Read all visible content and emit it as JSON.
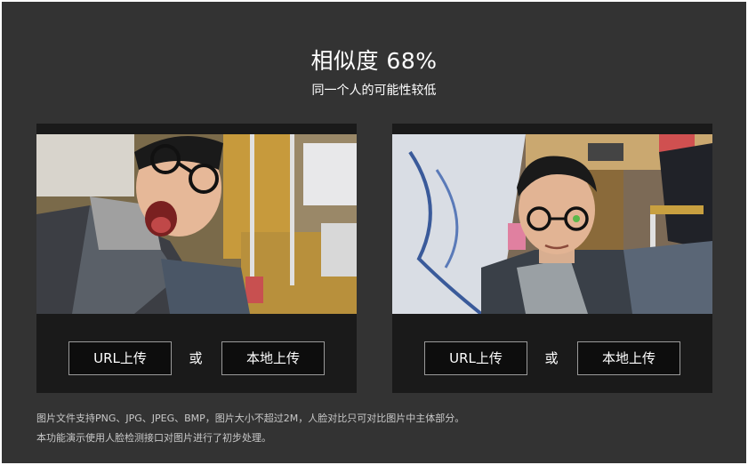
{
  "result": {
    "title": "相似度 68%",
    "subtitle": "同一个人的可能性较低"
  },
  "panels": [
    {
      "url_button": "URL上传",
      "or_text": "或",
      "local_button": "本地上传"
    },
    {
      "url_button": "URL上传",
      "or_text": "或",
      "local_button": "本地上传"
    }
  ],
  "notes": {
    "line1": "图片文件支持PNG、JPG、JPEG、BMP，图片大小不超过2M，人脸对比只可对比图片中主体部分。",
    "line2": "本功能演示使用人脸检测接口对图片进行了初步处理。"
  },
  "colors": {
    "background": "#333333",
    "panel": "#1a1a1a",
    "button_bg": "#0d0d0d",
    "button_border": "#9a9a9a",
    "text": "#ffffff",
    "note_text": "#c8c8c8"
  }
}
